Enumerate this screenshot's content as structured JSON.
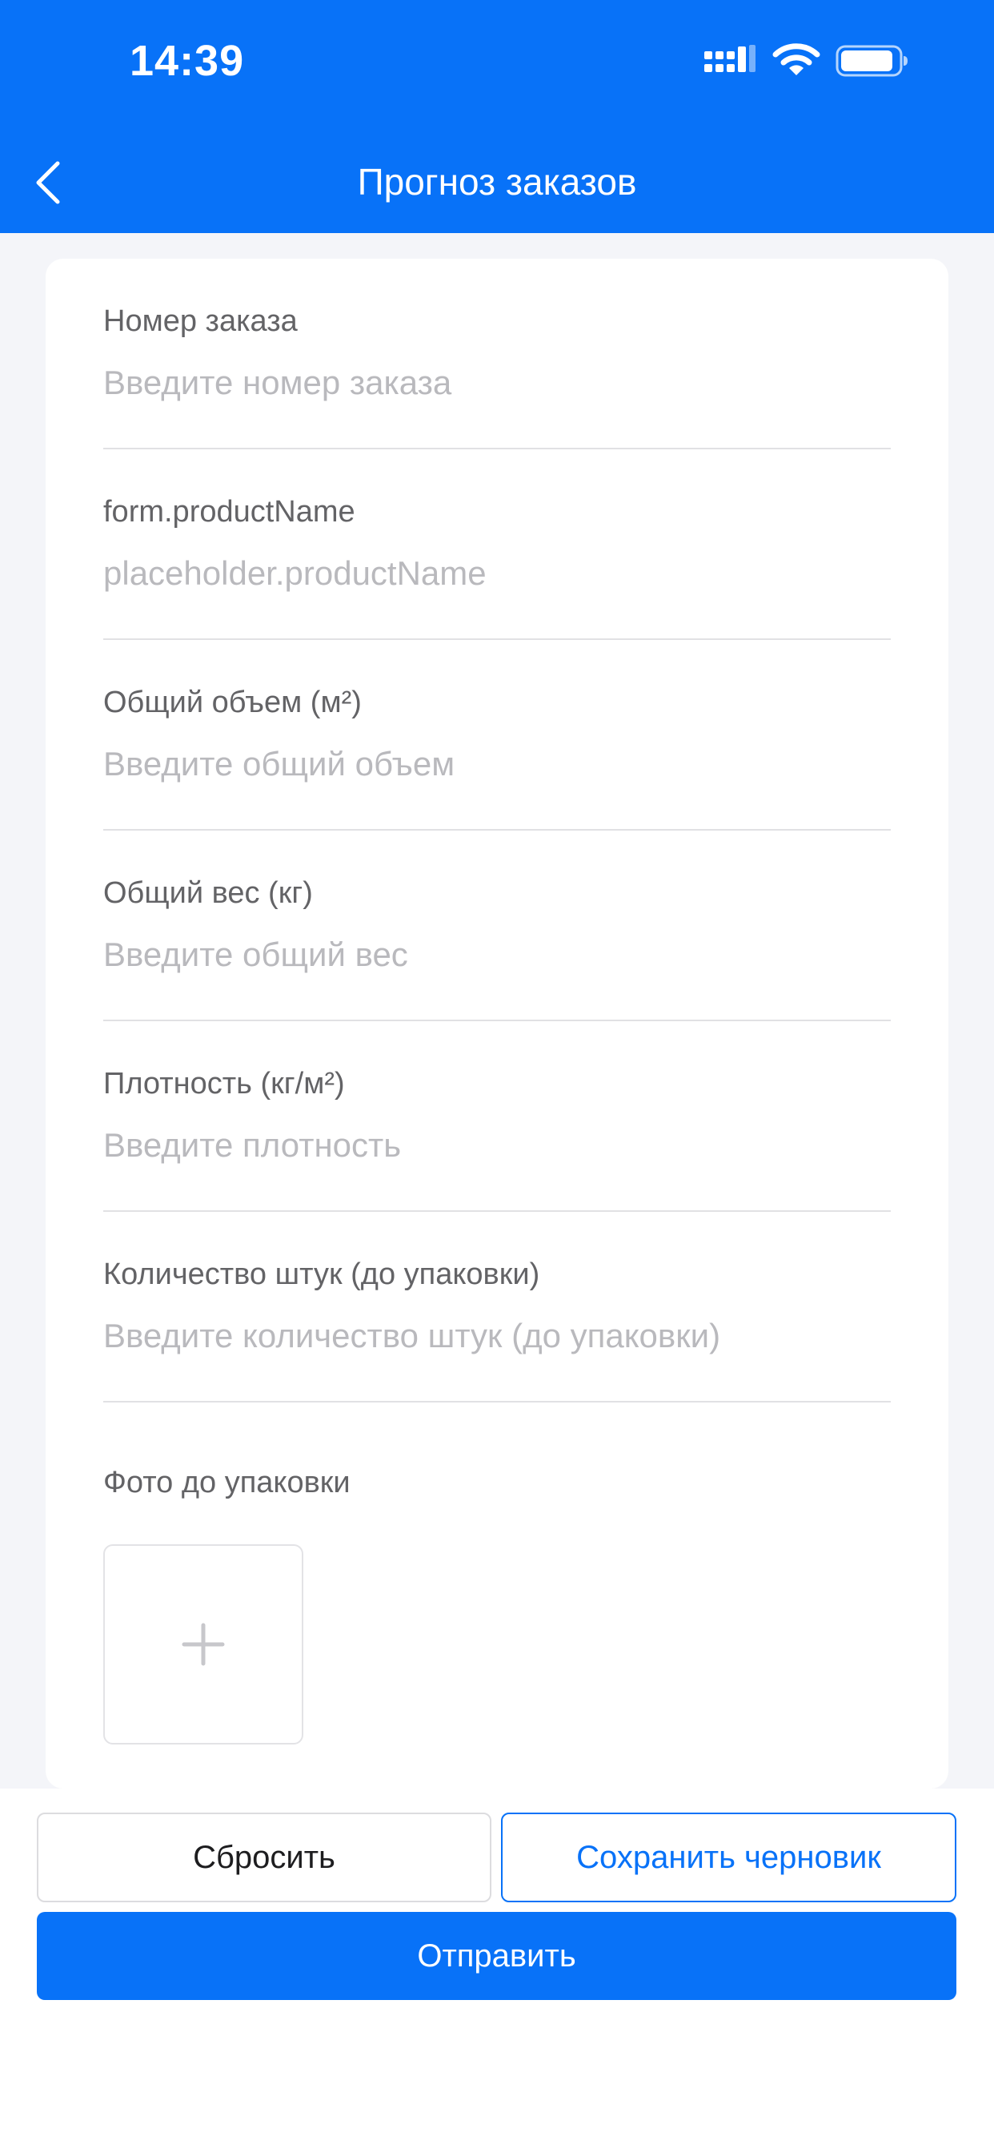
{
  "status_bar": {
    "time": "14:39",
    "icons": [
      "signal-icon",
      "wifi-icon",
      "battery-icon"
    ]
  },
  "nav": {
    "back_icon": "chevron-left-icon",
    "title": "Прогноз заказов"
  },
  "form": {
    "fields": [
      {
        "label": "Номер заказа",
        "placeholder": "Введите номер заказа",
        "value": ""
      },
      {
        "label": "form.productName",
        "placeholder": "placeholder.productName",
        "value": ""
      },
      {
        "label": "Общий объем (м²)",
        "placeholder": "Введите общий объем",
        "value": ""
      },
      {
        "label": "Общий вес (кг)",
        "placeholder": "Введите общий вес",
        "value": ""
      },
      {
        "label": "Плотность (кг/м²)",
        "placeholder": "Введите плотность",
        "value": ""
      },
      {
        "label": "Количество штук (до упаковки)",
        "placeholder": "Введите количество штук (до упаковки)",
        "value": ""
      }
    ],
    "photo_label": "Фото до упаковки",
    "photo_upload_icon": "plus-icon"
  },
  "actions": {
    "reset_label": "Сбросить",
    "draft_label": "Сохранить черновик",
    "submit_label": "Отправить"
  },
  "colors": {
    "primary": "#0872f8",
    "background": "#f4f5f9",
    "label": "#636366",
    "placeholder": "#b9b9bd",
    "divider": "#e1e1e4"
  }
}
